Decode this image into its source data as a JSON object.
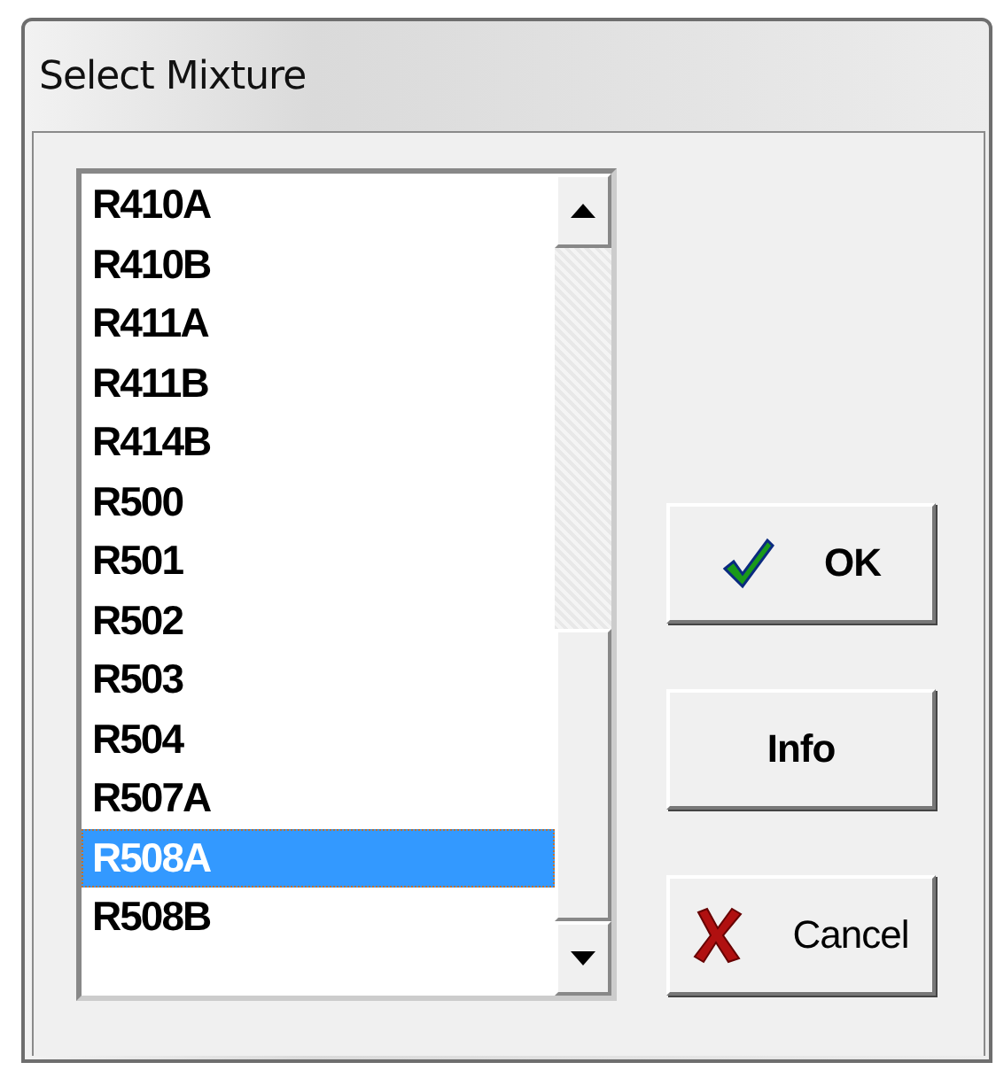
{
  "window": {
    "title": "Select Mixture"
  },
  "list": {
    "items": [
      {
        "label": "R410A",
        "selected": false
      },
      {
        "label": "R410B",
        "selected": false
      },
      {
        "label": "R411A",
        "selected": false
      },
      {
        "label": "R411B",
        "selected": false
      },
      {
        "label": "R414B",
        "selected": false
      },
      {
        "label": "R500",
        "selected": false
      },
      {
        "label": "R501",
        "selected": false
      },
      {
        "label": "R502",
        "selected": false
      },
      {
        "label": "R503",
        "selected": false
      },
      {
        "label": "R504",
        "selected": false
      },
      {
        "label": "R507A",
        "selected": false
      },
      {
        "label": "R508A",
        "selected": true
      },
      {
        "label": "R508B",
        "selected": false
      }
    ]
  },
  "buttons": [
    {
      "label": "OK",
      "kind": "ok"
    },
    {
      "label": "Info",
      "kind": "plain"
    },
    {
      "label": "Cancel",
      "kind": "cancel"
    }
  ]
}
